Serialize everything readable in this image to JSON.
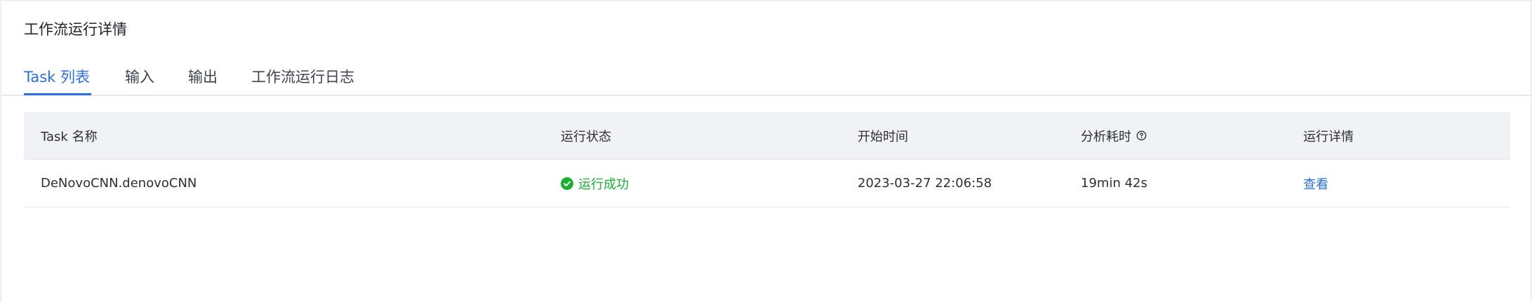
{
  "header": {
    "title": "工作流运行详情"
  },
  "tabs": [
    {
      "label": "Task 列表",
      "active": true
    },
    {
      "label": "输入",
      "active": false
    },
    {
      "label": "输出",
      "active": false
    },
    {
      "label": "工作流运行日志",
      "active": false
    }
  ],
  "table": {
    "columns": [
      "Task 名称",
      "运行状态",
      "开始时间",
      "分析耗时",
      "运行详情"
    ],
    "rows": [
      {
        "task_name": "DeNovoCNN.denovoCNN",
        "status": "运行成功",
        "start_time": "2023-03-27 22:06:58",
        "duration": "19min 42s",
        "detail_link": "查看"
      }
    ]
  },
  "colors": {
    "accent": "#2a6fdb",
    "success": "#19b030",
    "header_bg": "#f1f2f6",
    "border": "#e6e8eb"
  },
  "icons": {
    "status": "check-circle-icon",
    "column_help": "question-circle-icon"
  }
}
